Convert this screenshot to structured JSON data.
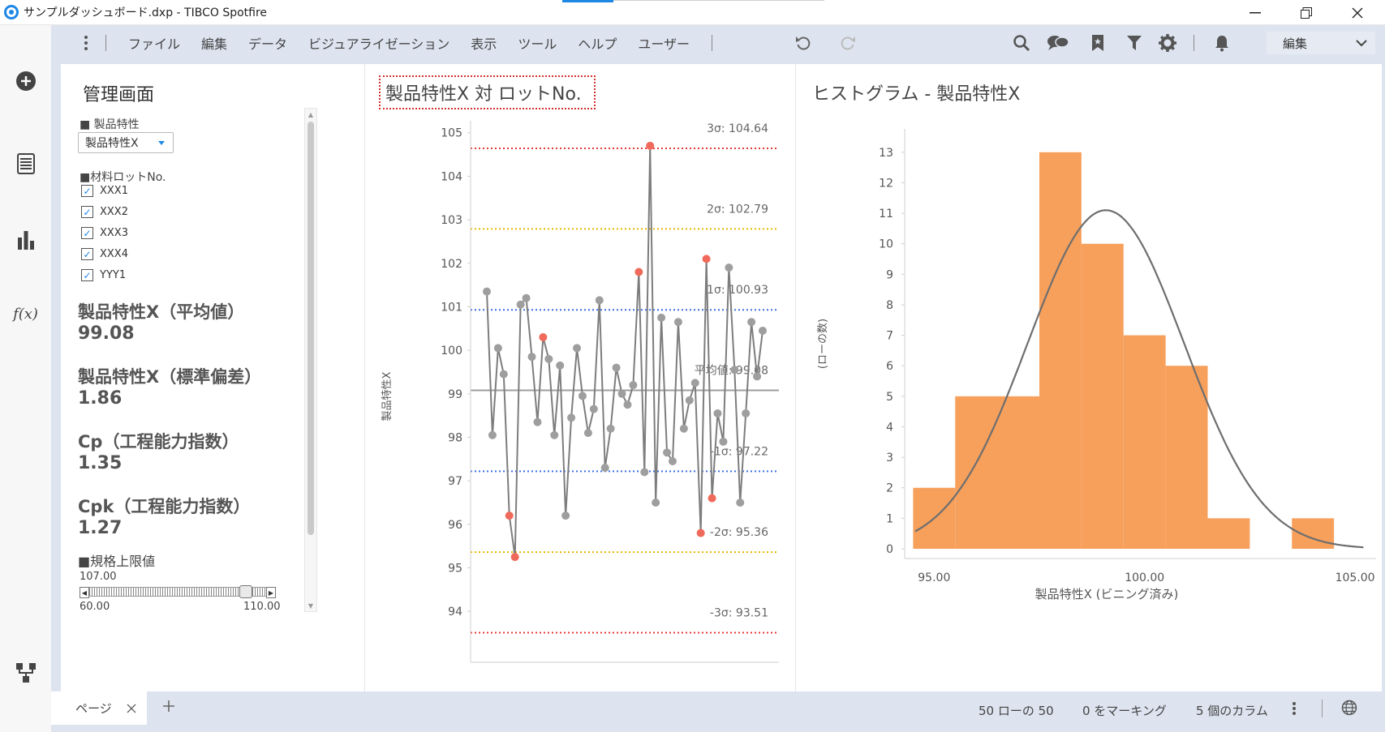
{
  "window": {
    "title": "サンプルダッシュボード.dxp - TIBCO Spotfire"
  },
  "menu": {
    "items": [
      "ファイル",
      "編集",
      "データ",
      "ビジュアライゼーション",
      "表示",
      "ツール",
      "ヘルプ",
      "ユーザー"
    ],
    "mode_select": "編集"
  },
  "control_panel": {
    "title": "管理画面",
    "property_label": "■ 製品特性",
    "property_value": "製品特性X",
    "lot_label": "■材料ロットNo.",
    "lots": [
      "XXX1",
      "XXX2",
      "XXX3",
      "XXX4",
      "YYY1"
    ],
    "kpis": [
      {
        "label": "製品特性X（平均値）",
        "value": "99.08"
      },
      {
        "label": "製品特性X（標準偏差）",
        "value": "1.86"
      },
      {
        "label": "Cp（工程能力指数）",
        "value": "1.35"
      },
      {
        "label": "Cpk（工程能力指数）",
        "value": "1.27"
      }
    ],
    "usl_label": "■規格上限値",
    "usl_value": "107.00",
    "slider_min": "60.00",
    "slider_max": "110.00"
  },
  "chart_data": [
    {
      "type": "line",
      "title": "製品特性X 対 ロットNo.",
      "ylabel": "製品特性X",
      "xlabel": "",
      "ylim": [
        93.5,
        105.2
      ],
      "yticks": [
        94,
        95,
        96,
        97,
        98,
        99,
        100,
        101,
        102,
        103,
        104,
        105
      ],
      "series": [
        {
          "values": [
            101.35,
            98.05,
            100.05,
            99.45,
            96.2,
            95.25,
            101.05,
            101.2,
            99.85,
            98.35,
            100.3,
            99.8,
            98.05,
            99.65,
            96.2,
            98.45,
            100.05,
            98.95,
            98.1,
            98.65,
            101.15,
            97.3,
            98.2,
            99.6,
            99.0,
            98.75,
            99.2,
            101.8,
            97.2,
            104.7,
            96.5,
            100.75,
            97.65,
            97.45,
            100.65,
            98.2,
            98.85,
            99.25,
            95.8,
            102.1,
            96.6,
            98.55,
            97.9,
            101.9,
            99.55,
            96.5,
            98.55,
            100.65,
            99.4,
            100.45
          ]
        }
      ],
      "outliers": [
        4,
        5,
        10,
        27,
        29,
        38,
        39,
        40
      ],
      "reference_lines": [
        {
          "label": "3σ: 104.64",
          "value": 104.64,
          "color": "#e53935"
        },
        {
          "label": "2σ: 102.79",
          "value": 102.79,
          "color": "#e6b800"
        },
        {
          "label": "1σ: 100.93",
          "value": 100.93,
          "color": "#3b6fe0"
        },
        {
          "label": "平均値: 99.08",
          "value": 99.08,
          "color": "#9e9e9e"
        },
        {
          "label": "-1σ: 97.22",
          "value": 97.22,
          "color": "#3b6fe0"
        },
        {
          "label": "-2σ: 95.36",
          "value": 95.36,
          "color": "#e6b800"
        },
        {
          "label": "-3σ: 93.51",
          "value": 93.51,
          "color": "#e53935"
        }
      ],
      "colors": {
        "line": "#7d7d7d",
        "point": "#9e9e9e",
        "outlier": "#ef6a5b"
      }
    },
    {
      "type": "bar",
      "title": "ヒストグラム - 製品特性X",
      "xlabel": "製品特性X (ビニング済み)",
      "ylabel": "(ローの数)",
      "x_bins": [
        [
          94.5,
          95.5
        ],
        [
          95.5,
          97.5
        ],
        [
          97.5,
          98.5
        ],
        [
          98.5,
          99.5
        ],
        [
          99.5,
          100.5
        ],
        [
          100.5,
          101.5
        ],
        [
          101.5,
          102.5
        ],
        [
          103.5,
          104.5
        ]
      ],
      "values": [
        2,
        5,
        13,
        10,
        7,
        6,
        1,
        1
      ],
      "xticks": [
        "95.00",
        "100.00",
        "105.00"
      ],
      "xtick_values": [
        95,
        100,
        105
      ],
      "yticks": [
        0,
        1,
        2,
        3,
        4,
        5,
        6,
        7,
        8,
        9,
        10,
        11,
        12,
        13
      ],
      "xlim": [
        94.3,
        105.5
      ],
      "ylim": [
        0,
        13.5
      ],
      "normal_curve": {
        "mean": 99.08,
        "sd": 1.86,
        "peak": 11.1
      },
      "colors": {
        "bar": "#f7a05c",
        "curve": "#6e6e6e"
      }
    }
  ],
  "status": {
    "page_tab": "ページ",
    "rows": "50 ローの 50",
    "marking": "0 をマーキング",
    "columns": "5 個のカラム"
  }
}
